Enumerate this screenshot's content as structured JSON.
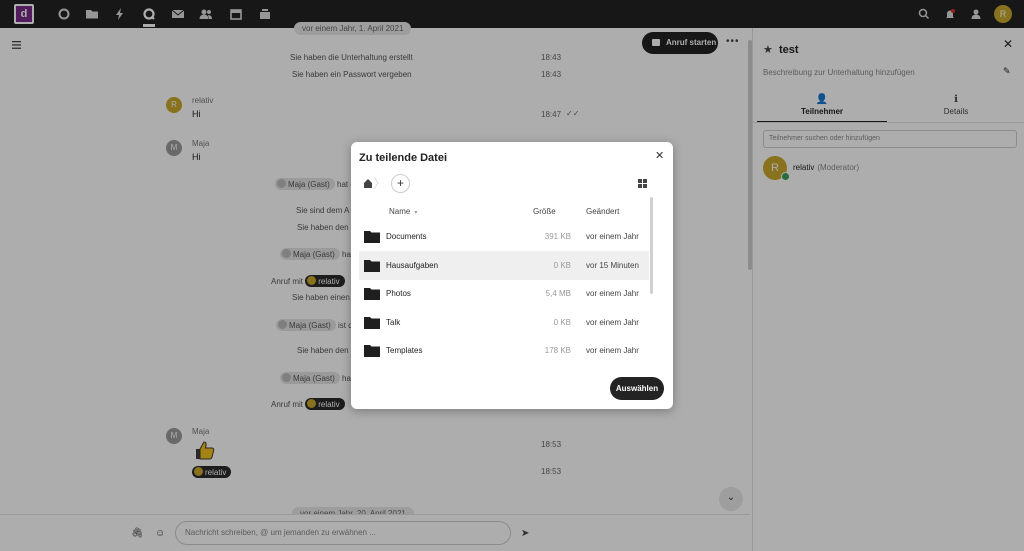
{
  "topbar": {
    "logo_letter": "d",
    "apps": [
      "dashboard-icon",
      "files-icon",
      "activity-icon",
      "talk-icon",
      "mail-icon",
      "contacts-icon",
      "calendar-icon",
      "deck-icon"
    ],
    "avatar_letter": "R"
  },
  "chat": {
    "date_chip_top": "vor einem Jahr, 1. April 2021",
    "date_chip_bottom": "vor einem Jahr, 20. April 2021",
    "call_button": "Anruf starten",
    "events": [
      {
        "text": "Sie haben die Unterhaltung erstellt",
        "time": "18:43"
      },
      {
        "text": "Sie haben ein Passwort vergeben",
        "time": "18:43"
      }
    ],
    "msg1": {
      "avatar": "R",
      "author": "relativ",
      "text": "Hi",
      "time": "18:47"
    },
    "msg2": {
      "avatar": "M",
      "author": "Maja",
      "text": "Hi"
    },
    "guest_name": "Maja (Gast)",
    "frag_hat_e": "hat e",
    "frag_sie_sind_dem": "Sie sind dem A",
    "frag_sie_haben_den_1": "Sie haben den",
    "frag_hat_2": "hat",
    "frag_anruf_mit_1": "Anruf mit",
    "mention_relativ": "relativ",
    "frag_sie_haben_einen": "Sie haben einen",
    "frag_ist_d": "ist d",
    "frag_sie_haben_den_2": "Sie haben den",
    "frag_hat_3": "hat",
    "frag_anruf_mit_2": "Anruf mit",
    "msg3": {
      "avatar": "M",
      "author": "Maja",
      "time_thumb": "18:53",
      "time_mention": "18:53"
    },
    "composer_placeholder": "Nachricht schreiben, @ um jemanden zu erwähnen ..."
  },
  "sidebar": {
    "title": "test",
    "description_placeholder": "Beschreibung zur Unterhaltung hinzufügen",
    "tabs": [
      {
        "label": "Teilnehmer"
      },
      {
        "label": "Details"
      }
    ],
    "search_placeholder": "Teilnehmer suchen oder hinzufügen",
    "participant": {
      "avatar": "R",
      "name": "relativ",
      "role": "(Moderator)"
    }
  },
  "modal": {
    "title": "Zu teilende Datei",
    "columns": {
      "name": "Name",
      "size": "Größe",
      "modified": "Geändert"
    },
    "files": [
      {
        "name": "Documents",
        "size": "391 KB",
        "modified": "vor einem Jahr"
      },
      {
        "name": "Hausaufgaben",
        "size": "0 KB",
        "modified": "vor 15 Minuten"
      },
      {
        "name": "Photos",
        "size": "5,4 MB",
        "modified": "vor einem Jahr"
      },
      {
        "name": "Talk",
        "size": "0 KB",
        "modified": "vor einem Jahr"
      },
      {
        "name": "Templates",
        "size": "178 KB",
        "modified": "vor einem Jahr"
      }
    ],
    "select_button": "Auswählen"
  },
  "colors": {
    "topbar": "#232323",
    "logo": "#7b2a8a",
    "avatar_user": "#c9a82c",
    "online": "#3a9e61"
  }
}
